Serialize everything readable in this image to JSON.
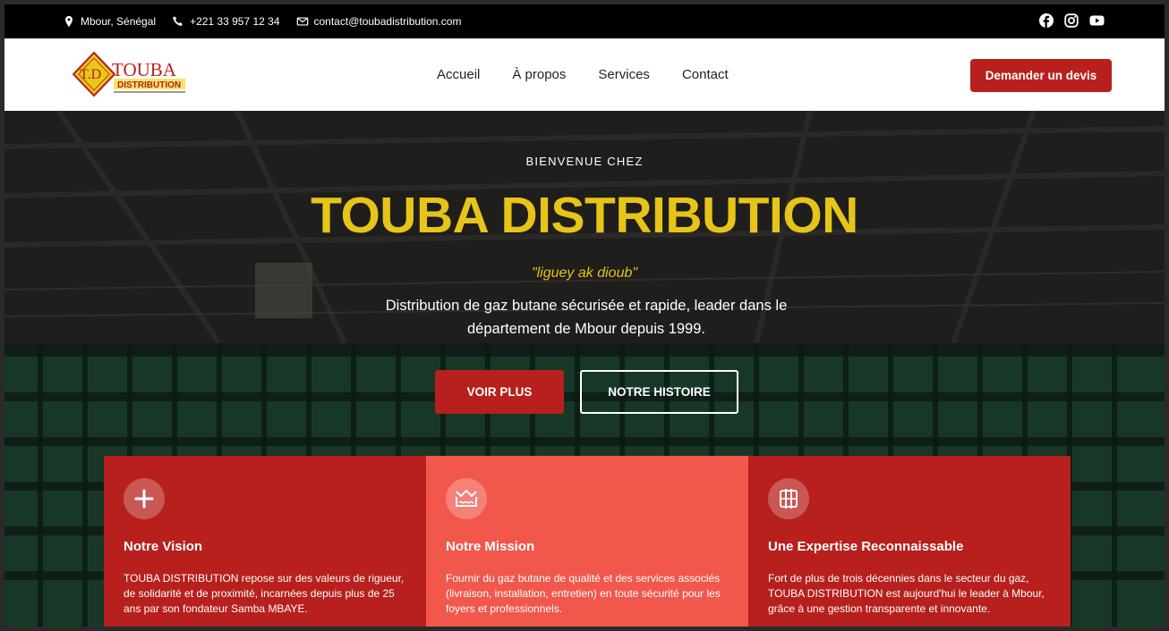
{
  "topbar": {
    "location": "Mbour, Sénégal",
    "phone": "+221 33 957 12 34",
    "email": "contact@toubadistribution.com",
    "social_icons": [
      "facebook-icon",
      "instagram-icon",
      "youtube-icon"
    ]
  },
  "header": {
    "logo": {
      "initials": "T.D",
      "name": "TOUBA",
      "sub": "DISTRIBUTION"
    },
    "nav": [
      "Accueil",
      "À propos",
      "Services",
      "Contact"
    ],
    "cta": "Demander un devis"
  },
  "hero": {
    "welcome": "BIENVENUE CHEZ",
    "title": "TOUBA DISTRIBUTION",
    "motto": "\"liguey ak dioub\"",
    "description": "Distribution de gaz butane sécurisée et rapide, leader dans le département de Mbour depuis 1999.",
    "primary_button": "VOIR PLUS",
    "secondary_button": "NOTRE HISTOIRE"
  },
  "cards": [
    {
      "icon": "plus-icon",
      "title": "Notre Vision",
      "text": "TOUBA DISTRIBUTION repose sur des valeurs de rigueur, de solidarité et de proximité, incarnées depuis plus de 25 ans par son fondateur Samba MBAYE."
    },
    {
      "icon": "wave-icon",
      "title": "Notre Mission",
      "text": "Fournir du gaz butane de qualité et des services associés (livraison, installation, entretien) en toute sécurité pour les foyers et professionnels."
    },
    {
      "icon": "columns-icon",
      "title": "Une Expertise Reconnaissable",
      "text": "Fort de plus de trois décennies dans le secteur du gaz, TOUBA DISTRIBUTION est aujourd'hui le leader à Mbour, grâce à une gestion transparente et innovante."
    }
  ],
  "colors": {
    "brand_red": "#b7201c",
    "accent_coral": "#f2574b",
    "brand_yellow": "#e6c419"
  }
}
